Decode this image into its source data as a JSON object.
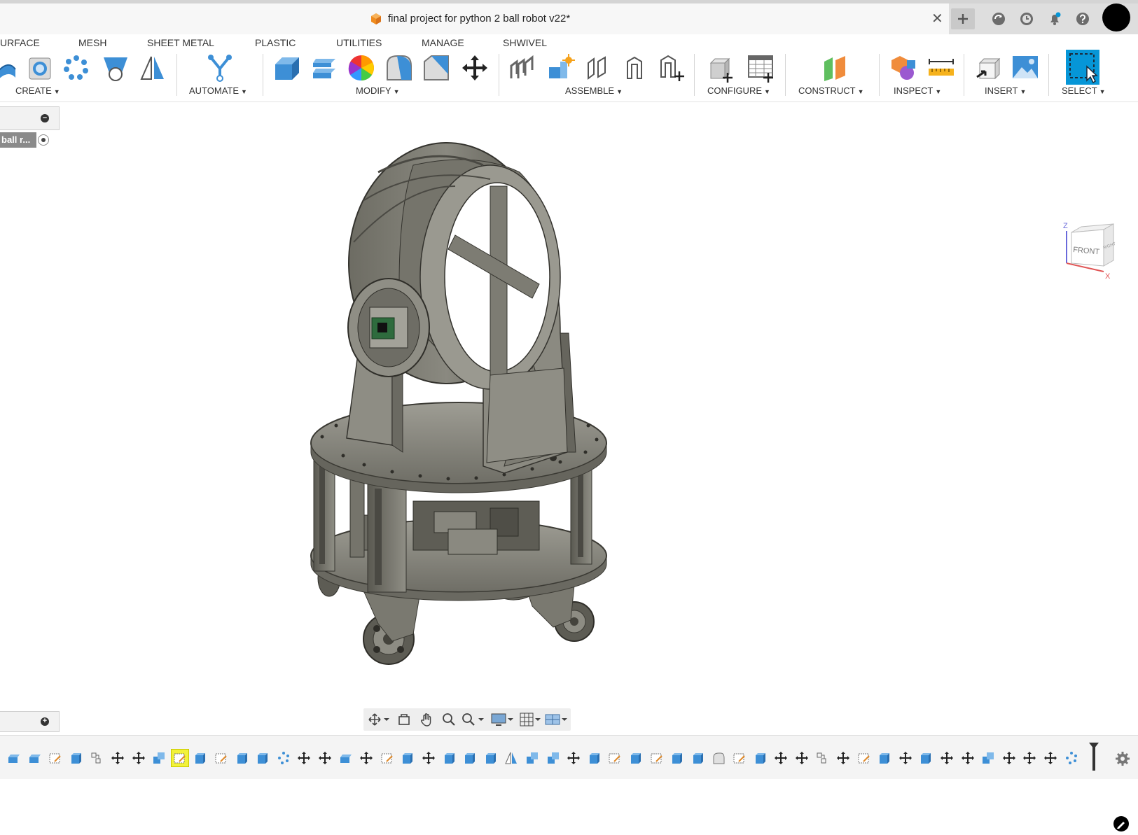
{
  "window": {
    "document_title": "final project for python 2 ball robot v22*",
    "close_glyph": "✕"
  },
  "ribbon_tabs": [
    "URFACE",
    "MESH",
    "SHEET METAL",
    "PLASTIC",
    "UTILITIES",
    "MANAGE",
    "SHWIVEL"
  ],
  "toolbar_groups": [
    {
      "name": "CREATE"
    },
    {
      "name": "AUTOMATE"
    },
    {
      "name": "MODIFY"
    },
    {
      "name": "ASSEMBLE"
    },
    {
      "name": "CONFIGURE"
    },
    {
      "name": "CONSTRUCT"
    },
    {
      "name": "INSPECT"
    },
    {
      "name": "INSERT"
    },
    {
      "name": "SELECT"
    }
  ],
  "browser": {
    "root_label": "ball r..."
  },
  "viewcube": {
    "face_front": "FRONT",
    "face_right": "RIGHT",
    "axis_z": "Z",
    "axis_x": "X"
  },
  "colors": {
    "accent": "#0696d7",
    "model_dark": "#5e5d55",
    "model_mid": "#8b8a82",
    "model_light": "#a9a89f",
    "timeline_highlight": "#f2f23a"
  },
  "timeline": {
    "highlighted_index": 8
  }
}
